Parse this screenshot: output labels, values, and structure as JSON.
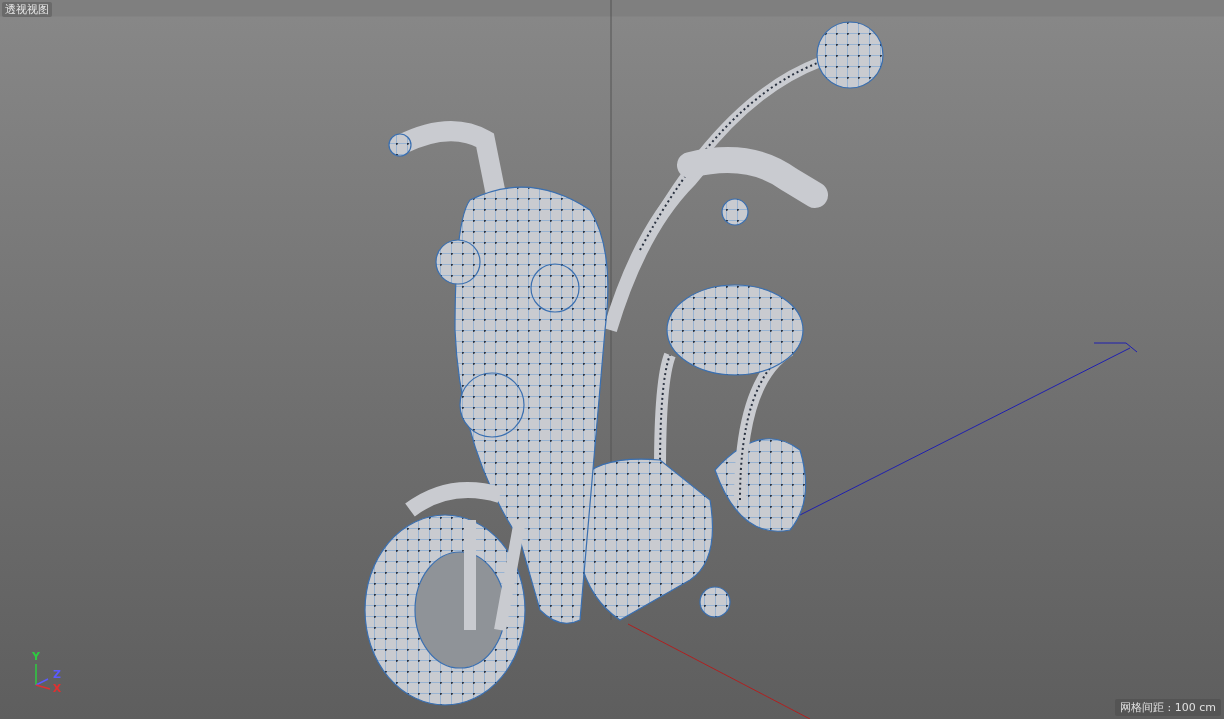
{
  "viewport": {
    "title": "透视视图",
    "grid_spacing": "网格间距 : 100 cm",
    "axis_gizmo": [
      {
        "kind": "y",
        "label": "Y",
        "color": "#2ecc40"
      },
      {
        "kind": "z",
        "label": "Z",
        "color": "#5a5aff"
      },
      {
        "kind": "x",
        "label": "X",
        "color": "#e03030"
      }
    ]
  }
}
